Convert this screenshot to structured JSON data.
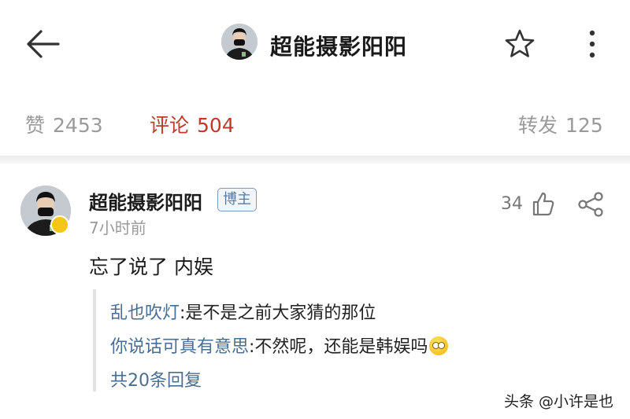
{
  "header": {
    "title": "超能摄影阳阳",
    "back_icon": "arrow-left-icon",
    "star_icon": "star-outline-icon",
    "more_icon": "more-vertical-icon"
  },
  "stats": {
    "likes_label": "赞",
    "likes_count": "2453",
    "comments_label": "评论",
    "comments_count": "504",
    "reposts_label": "转发",
    "reposts_count": "125",
    "active_color": "#c0392b"
  },
  "comment": {
    "author": "超能摄影阳阳",
    "tag": "博主",
    "time": "7小时前",
    "like_count": "34",
    "text": "忘了说了 内娱",
    "replies": [
      {
        "user": "乱也吹灯",
        "text": ":是不是之前大家猜的那位"
      },
      {
        "user": "你说话可真有意思",
        "text": ":不然呢，还能是韩娱吗"
      }
    ],
    "more_replies": "共20条回复"
  },
  "watermark": "头条 @小许是也"
}
